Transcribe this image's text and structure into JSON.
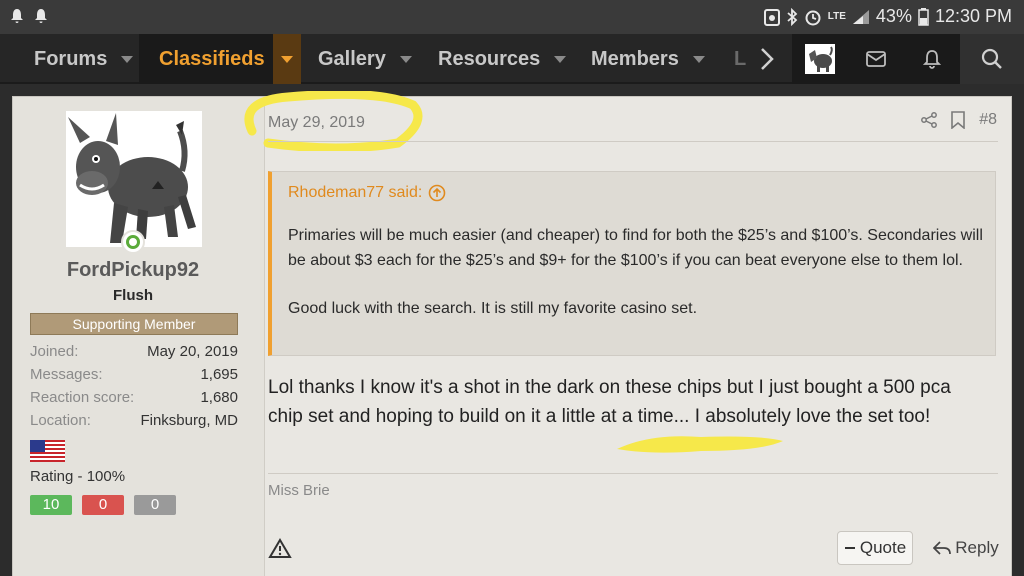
{
  "status_bar": {
    "battery_percent": "43%",
    "time": "12:30 PM",
    "network": "LTE"
  },
  "nav": {
    "items": [
      {
        "label": "Forums"
      },
      {
        "label": "Classifieds",
        "active": true
      },
      {
        "label": "Gallery"
      },
      {
        "label": "Resources"
      },
      {
        "label": "Members"
      },
      {
        "label": "L"
      }
    ]
  },
  "user": {
    "name": "FordPickup92",
    "title": "Flush",
    "banner": "Supporting Member",
    "stats": [
      {
        "key": "Joined:",
        "value": "May 20, 2019"
      },
      {
        "key": "Messages:",
        "value": "1,695"
      },
      {
        "key": "Reaction score:",
        "value": "1,680"
      },
      {
        "key": "Location:",
        "value": "Finksburg, MD"
      }
    ],
    "rating": "Rating - 100%",
    "rating_badges": [
      "10",
      "0",
      "0"
    ]
  },
  "post": {
    "date": "May 29, 2019",
    "number": "#8",
    "quote_author": "Rhodeman77 said:",
    "quote_paragraphs": [
      "Primaries will be much easier (and cheaper) to find for both the $25’s and $100’s. Secondaries will be about $3 each for the $25’s and $9+ for the $100’s if you can beat everyone else to them lol.",
      "Good luck with the search. It is still my favorite casino set."
    ],
    "message": "Lol thanks I know it's a shot in the dark on these chips but I just bought a 500 pca chip set and hoping to build on it a little at a time... I absolutely love the set too!",
    "signature": "Miss Brie",
    "quote_button": "Quote",
    "reply_button": "Reply"
  },
  "colors": {
    "accent": "#f0a030",
    "rating_positive": "#5cb85c",
    "rating_negative": "#d9534f",
    "rating_neutral": "#9a9a9a",
    "highlight_marker": "#f6e84a"
  }
}
